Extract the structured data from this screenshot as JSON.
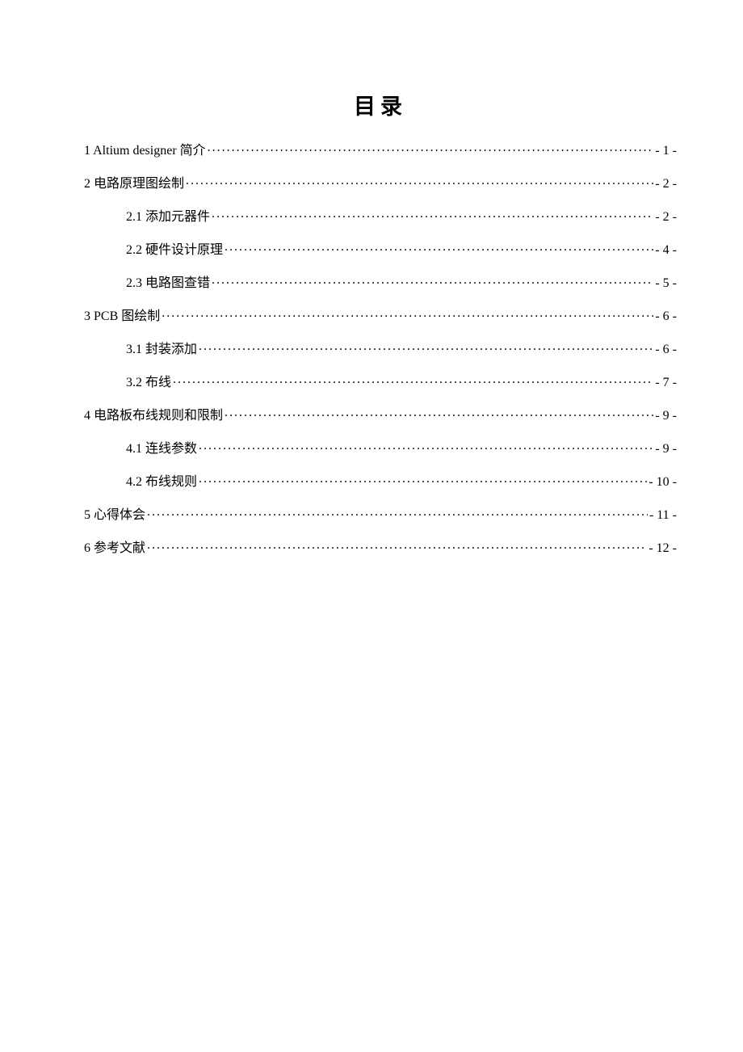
{
  "title": "目录",
  "toc": [
    {
      "level": 0,
      "label": "1  Altium  designer 简介 ",
      "page": "- 1 -"
    },
    {
      "level": 0,
      "label": "2  电路原理图绘制",
      "page": "- 2 -"
    },
    {
      "level": 1,
      "label": "2.1  添加元器件",
      "page": "- 2 -"
    },
    {
      "level": 1,
      "label": "2.2  硬件设计原理",
      "page": "- 4 -"
    },
    {
      "level": 1,
      "label": "2.3  电路图查错",
      "page": "- 5 -"
    },
    {
      "level": 0,
      "label": "3  PCB 图绘制 ",
      "page": "- 6 -"
    },
    {
      "level": 1,
      "label": "3.1  封装添加",
      "page": "- 6 -"
    },
    {
      "level": 1,
      "label": "3.2    布线",
      "page": "- 7 -"
    },
    {
      "level": 0,
      "label": "4  电路板布线规则和限制",
      "page": "- 9 -"
    },
    {
      "level": 1,
      "label": "4.1 连线参数",
      "page": "- 9 -"
    },
    {
      "level": 1,
      "label": "4.2 布线规则",
      "page": "- 10 -"
    },
    {
      "level": 0,
      "label": "5  心得体会",
      "page": "- 11 -"
    },
    {
      "level": 0,
      "label": "6  参考文献",
      "page": "- 12 -"
    }
  ]
}
